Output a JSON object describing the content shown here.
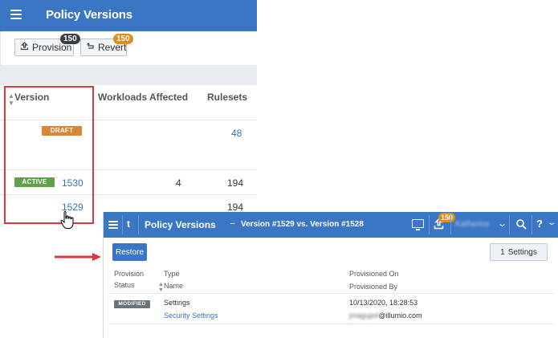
{
  "background_window": {
    "title": "Policy Versions",
    "toolbar": {
      "provision_label": "Provision",
      "provision_badge": "150",
      "revert_label": "Revert",
      "revert_badge": "150"
    },
    "table": {
      "columns": [
        "Version",
        "Workloads Affected",
        "Rulesets"
      ],
      "rows": [
        {
          "status": "DRAFT",
          "version": "",
          "workloads": "",
          "rulesets": "48"
        },
        {
          "status": "ACTIVE",
          "version": "1530",
          "workloads": "4",
          "rulesets": "194"
        },
        {
          "status": "",
          "version": "1529",
          "workloads": "",
          "rulesets": "194"
        }
      ]
    }
  },
  "foreground_window": {
    "title": "Policy Versions",
    "separator": "–",
    "subtitle": "Version #1529 vs. Version #1528",
    "provision_badge": "150",
    "user_name": "Katherine",
    "help_label": "?",
    "back_label": "t",
    "restore_label": "Restore",
    "settings_count": "1",
    "settings_label": "Settings",
    "columns": {
      "provision_status": [
        "Provision",
        "Status"
      ],
      "type": "Type",
      "name": "Name",
      "provisioned_on": "Provisioned On",
      "provisioned_by": "Provisioned By"
    },
    "row": {
      "status": "MODIFIED",
      "type": "Settings",
      "name": "Security Settings",
      "provisioned_on": "10/13/2020, 18:28:53",
      "provisioned_by_user": "jmagupol",
      "provisioned_by_domain": "@illumio.com"
    }
  },
  "colors": {
    "header_blue": "#3b76c4",
    "draft_orange": "#d5883a",
    "active_green": "#5fa04e",
    "modified_gray": "#6b7279",
    "highlight_red": "#e0373a",
    "badge_orange": "#e08b1b"
  },
  "icons": {
    "menu": "hamburger-icon",
    "provision": "upload-icon",
    "revert": "undo-icon",
    "monitor": "monitor-icon",
    "search": "search-icon",
    "chevron": "chevron-down-icon",
    "cursor": "hand-pointer-icon",
    "arrow": "red-arrow-icon"
  }
}
